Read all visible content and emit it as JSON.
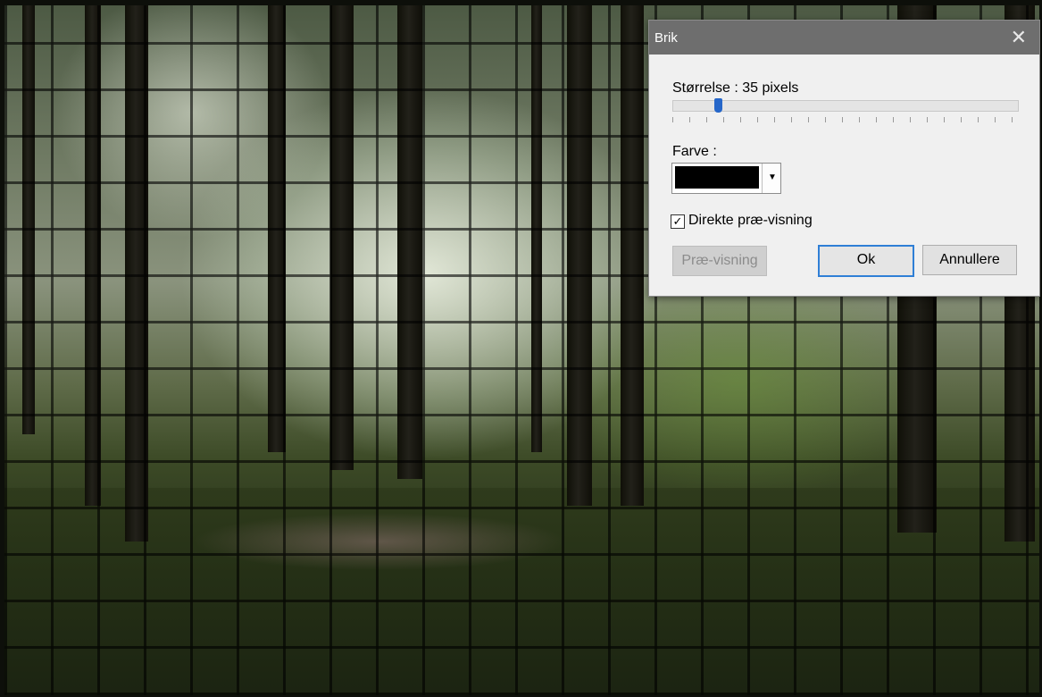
{
  "dialog": {
    "title": "Brik",
    "size_label": "Størrelse : 35 pixels",
    "size_value": 35,
    "color_label": "Farve :",
    "color_value": "#000000",
    "live_preview_label": "Direkte præ-visning",
    "live_preview_checked": true,
    "preview_button": "Præ-visning",
    "ok_button": "Ok",
    "cancel_button": "Annullere"
  },
  "icons": {
    "close": "close-icon",
    "checkmark": "checkmark-icon",
    "dropdown": "chevron-down-icon"
  },
  "colors": {
    "titlebar": "#6e6e6e",
    "dialog_bg": "#f0f0f0",
    "slider_thumb": "#2566c9",
    "ok_focus": "#2f7fd6"
  }
}
